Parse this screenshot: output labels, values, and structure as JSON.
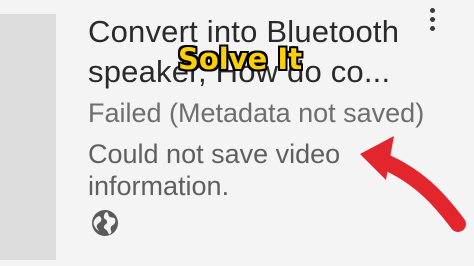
{
  "card": {
    "title_line1": "Convert into Bluetooth",
    "title_line2": "speaker, How do co...",
    "status": "Failed (Metadata not saved)",
    "error_message": "Could not save video information."
  },
  "overlay": {
    "text": "Solve It",
    "color": "#ffd000"
  },
  "icons": {
    "more": "more-vert-icon",
    "globe": "globe-icon",
    "arrow": "curved-arrow-icon"
  },
  "colors": {
    "arrow": "#e3262e",
    "title": "#2a2a2a",
    "status": "#6e6e6e"
  }
}
